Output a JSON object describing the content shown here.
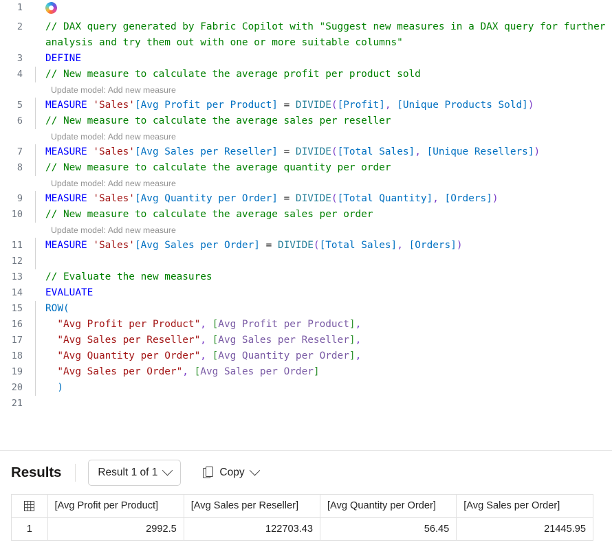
{
  "editor": {
    "language": "dax",
    "copilot_icon": "copilot-icon",
    "lines": [
      {
        "num": "1",
        "indent_guide": false,
        "tokens": []
      },
      {
        "num": "2",
        "indent_guide": false,
        "tokens": [
          {
            "c": "t-comment",
            "t": "// DAX query generated by Fabric Copilot with \"Suggest new measures in a DAX query for further analysis and try them out with one or more suitable columns\""
          }
        ]
      },
      {
        "num": "3",
        "indent_guide": false,
        "tokens": [
          {
            "c": "t-keyword",
            "t": "DEFINE"
          }
        ]
      },
      {
        "num": "4",
        "indent_guide": true,
        "tokens": [
          {
            "c": "t-comment",
            "t": "// New measure to calculate the average profit per product sold"
          }
        ]
      },
      {
        "codelens": "Update model: Add new measure"
      },
      {
        "num": "5",
        "indent_guide": true,
        "tokens": [
          {
            "c": "t-keyword",
            "t": "MEASURE"
          },
          {
            "c": "t-op",
            "t": " "
          },
          {
            "c": "t-table",
            "t": "'Sales'"
          },
          {
            "c": "t-column",
            "t": "[Avg Profit per Product]"
          },
          {
            "c": "t-op",
            "t": " = "
          },
          {
            "c": "t-func",
            "t": "DIVIDE"
          },
          {
            "c": "t-paren1",
            "t": "("
          },
          {
            "c": "t-column",
            "t": "[Profit]"
          },
          {
            "c": "t-punct",
            "t": ","
          },
          {
            "c": "t-op",
            "t": " "
          },
          {
            "c": "t-column",
            "t": "[Unique Products Sold]"
          },
          {
            "c": "t-paren1",
            "t": ")"
          }
        ]
      },
      {
        "num": "6",
        "indent_guide": true,
        "tokens": [
          {
            "c": "t-comment",
            "t": "// New measure to calculate the average sales per reseller"
          }
        ]
      },
      {
        "codelens": "Update model: Add new measure"
      },
      {
        "num": "7",
        "indent_guide": true,
        "tokens": [
          {
            "c": "t-keyword",
            "t": "MEASURE"
          },
          {
            "c": "t-op",
            "t": " "
          },
          {
            "c": "t-table",
            "t": "'Sales'"
          },
          {
            "c": "t-column",
            "t": "[Avg Sales per Reseller]"
          },
          {
            "c": "t-op",
            "t": " = "
          },
          {
            "c": "t-func",
            "t": "DIVIDE"
          },
          {
            "c": "t-paren1",
            "t": "("
          },
          {
            "c": "t-column",
            "t": "[Total Sales]"
          },
          {
            "c": "t-punct",
            "t": ","
          },
          {
            "c": "t-op",
            "t": " "
          },
          {
            "c": "t-column",
            "t": "[Unique Resellers]"
          },
          {
            "c": "t-paren1",
            "t": ")"
          }
        ]
      },
      {
        "num": "8",
        "indent_guide": true,
        "tokens": [
          {
            "c": "t-comment",
            "t": "// New measure to calculate the average quantity per order"
          }
        ]
      },
      {
        "codelens": "Update model: Add new measure"
      },
      {
        "num": "9",
        "indent_guide": true,
        "tokens": [
          {
            "c": "t-keyword",
            "t": "MEASURE"
          },
          {
            "c": "t-op",
            "t": " "
          },
          {
            "c": "t-table",
            "t": "'Sales'"
          },
          {
            "c": "t-column",
            "t": "[Avg Quantity per Order]"
          },
          {
            "c": "t-op",
            "t": " = "
          },
          {
            "c": "t-func",
            "t": "DIVIDE"
          },
          {
            "c": "t-paren1",
            "t": "("
          },
          {
            "c": "t-column",
            "t": "[Total Quantity]"
          },
          {
            "c": "t-punct",
            "t": ","
          },
          {
            "c": "t-op",
            "t": " "
          },
          {
            "c": "t-column",
            "t": "[Orders]"
          },
          {
            "c": "t-paren1",
            "t": ")"
          }
        ]
      },
      {
        "num": "10",
        "indent_guide": true,
        "tokens": [
          {
            "c": "t-comment",
            "t": "// New measure to calculate the average sales per order"
          }
        ]
      },
      {
        "codelens": "Update model: Add new measure"
      },
      {
        "num": "11",
        "indent_guide": true,
        "tokens": [
          {
            "c": "t-keyword",
            "t": "MEASURE"
          },
          {
            "c": "t-op",
            "t": " "
          },
          {
            "c": "t-table",
            "t": "'Sales'"
          },
          {
            "c": "t-column",
            "t": "[Avg Sales per Order]"
          },
          {
            "c": "t-op",
            "t": " = "
          },
          {
            "c": "t-func",
            "t": "DIVIDE"
          },
          {
            "c": "t-paren1",
            "t": "("
          },
          {
            "c": "t-column",
            "t": "[Total Sales]"
          },
          {
            "c": "t-punct",
            "t": ","
          },
          {
            "c": "t-op",
            "t": " "
          },
          {
            "c": "t-column",
            "t": "[Orders]"
          },
          {
            "c": "t-paren1",
            "t": ")"
          }
        ]
      },
      {
        "num": "12",
        "indent_guide": true,
        "tokens": []
      },
      {
        "num": "13",
        "indent_guide": false,
        "tokens": [
          {
            "c": "t-comment",
            "t": "// Evaluate the new measures"
          }
        ]
      },
      {
        "num": "14",
        "indent_guide": false,
        "tokens": [
          {
            "c": "t-keyword",
            "t": "EVALUATE"
          }
        ]
      },
      {
        "num": "15",
        "indent_guide": true,
        "tokens": [
          {
            "c": "t-paren2",
            "t": "ROW("
          }
        ]
      },
      {
        "num": "16",
        "indent_guide": true,
        "tokens": [
          {
            "c": "t-op",
            "t": "  "
          },
          {
            "c": "t-string",
            "t": "\"Avg Profit per Product\""
          },
          {
            "c": "t-punct",
            "t": ","
          },
          {
            "c": "t-op",
            "t": " "
          },
          {
            "c": "t-brk-g",
            "t": "["
          },
          {
            "c": "t-ref",
            "t": "Avg Profit per Product"
          },
          {
            "c": "t-brk-g",
            "t": "]"
          },
          {
            "c": "t-punct",
            "t": ","
          }
        ]
      },
      {
        "num": "17",
        "indent_guide": true,
        "tokens": [
          {
            "c": "t-op",
            "t": "  "
          },
          {
            "c": "t-string",
            "t": "\"Avg Sales per Reseller\""
          },
          {
            "c": "t-punct",
            "t": ","
          },
          {
            "c": "t-op",
            "t": " "
          },
          {
            "c": "t-brk-g",
            "t": "["
          },
          {
            "c": "t-ref",
            "t": "Avg Sales per Reseller"
          },
          {
            "c": "t-brk-g",
            "t": "]"
          },
          {
            "c": "t-punct",
            "t": ","
          }
        ]
      },
      {
        "num": "18",
        "indent_guide": true,
        "tokens": [
          {
            "c": "t-op",
            "t": "  "
          },
          {
            "c": "t-string",
            "t": "\"Avg Quantity per Order\""
          },
          {
            "c": "t-punct",
            "t": ","
          },
          {
            "c": "t-op",
            "t": " "
          },
          {
            "c": "t-brk-g",
            "t": "["
          },
          {
            "c": "t-ref",
            "t": "Avg Quantity per Order"
          },
          {
            "c": "t-brk-g",
            "t": "]"
          },
          {
            "c": "t-punct",
            "t": ","
          }
        ]
      },
      {
        "num": "19",
        "indent_guide": true,
        "tokens": [
          {
            "c": "t-op",
            "t": "  "
          },
          {
            "c": "t-string",
            "t": "\"Avg Sales per Order\""
          },
          {
            "c": "t-punct",
            "t": ","
          },
          {
            "c": "t-op",
            "t": " "
          },
          {
            "c": "t-brk-g",
            "t": "["
          },
          {
            "c": "t-ref",
            "t": "Avg Sales per Order"
          },
          {
            "c": "t-brk-g",
            "t": "]"
          }
        ]
      },
      {
        "num": "20",
        "indent_guide": true,
        "tokens": [
          {
            "c": "t-op",
            "t": "  "
          },
          {
            "c": "t-paren2",
            "t": ")"
          }
        ]
      },
      {
        "num": "21",
        "indent_guide": false,
        "tokens": []
      }
    ]
  },
  "results": {
    "title": "Results",
    "result_selector_label": "Result 1 of 1",
    "copy_label": "Copy",
    "copy_icon": "copy-icon",
    "grid_icon": "grid-icon",
    "chevron_icon": "chevron-down-icon",
    "columns": [
      "[Avg Profit per Product]",
      "[Avg Sales per Reseller]",
      "[Avg Quantity per Order]",
      "[Avg Sales per Order]"
    ],
    "rows": [
      {
        "index": "1",
        "values": [
          "2992.5",
          "122703.43",
          "56.45",
          "21445.95"
        ]
      }
    ]
  },
  "colors": {
    "comment": "#008000",
    "keyword": "#0000ff",
    "table_ref": "#a31515",
    "column_ref": "#0070c1",
    "function": "#267f99",
    "codelens": "#919191",
    "border": "#e1e1e1"
  }
}
